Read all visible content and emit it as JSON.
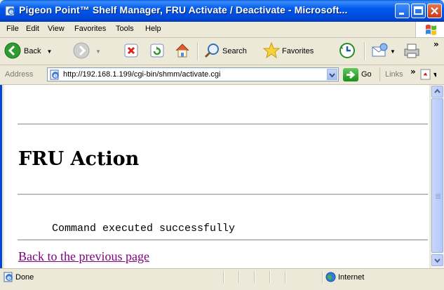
{
  "window": {
    "title": "Pigeon Point™ Shelf Manager, FRU Activate / Deactivate - Microsoft...",
    "title_bar_color": "#0058ee"
  },
  "menu": {
    "items": [
      "File",
      "Edit",
      "View",
      "Favorites",
      "Tools",
      "Help"
    ]
  },
  "toolbar": {
    "back_label": "Back",
    "search_label": "Search",
    "favorites_label": "Favorites"
  },
  "address": {
    "label": "Address",
    "url": "http://192.168.1.199/cgi-bin/shmm/activate.cgi",
    "go_label": "Go",
    "links_label": "Links"
  },
  "page": {
    "heading": "FRU Action",
    "message": "Command executed successfully",
    "back_link": "Back to the previous page",
    "link_color": "#800080"
  },
  "status": {
    "text": "Done",
    "zone": "Internet"
  }
}
